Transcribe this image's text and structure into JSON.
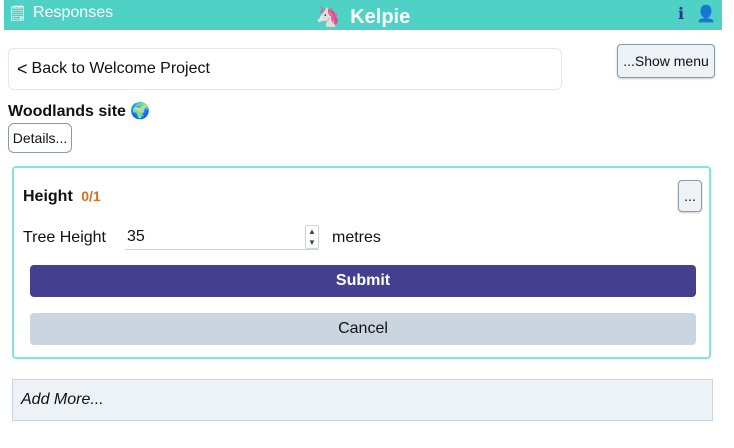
{
  "header": {
    "responses_icon": "document-icon",
    "responses_label": "Responses",
    "brand_logo": "🦄",
    "brand_title": "Kelpie",
    "info_icon": "ℹ",
    "user_icon": "👤"
  },
  "nav": {
    "back_label": "Back to Welcome Project",
    "show_menu_label": "...Show menu"
  },
  "site": {
    "title": "Woodlands site",
    "globe": "🌍",
    "details_label": "Details..."
  },
  "question": {
    "title": "Height",
    "count": "0/1",
    "more_label": "...",
    "field_label": "Tree Height",
    "field_value": "35",
    "unit": "metres",
    "submit_label": "Submit",
    "cancel_label": "Cancel"
  },
  "footer": {
    "add_more_label": "Add More..."
  },
  "colors": {
    "header_bg": "#4fd1c5",
    "submit_bg": "#44408f",
    "cancel_bg": "#cbd5e0",
    "card_border": "#81e6d9",
    "count_color": "#dd6b20"
  }
}
